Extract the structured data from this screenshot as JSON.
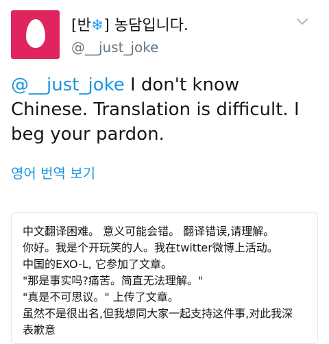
{
  "user": {
    "name_prefix": "[반",
    "name_emoji": "❄",
    "name_suffix": "] 농담입니다.",
    "handle": "@__just_joke"
  },
  "tweet": {
    "mention": "@__just_joke",
    "text": " I don't know Chinese. Translation is difficult. I beg your pardon."
  },
  "translate_link": "영어 번역 보기",
  "translation": {
    "lines": [
      "中文翻译困难。 意义可能会错。 翻译错误,请理解。",
      "你好。我是个开玩笑的人。我在twitter微博上活动。",
      "中国的EXO-L, 它参加了文章。",
      "\"那是事实吗?痛苦。简直无法理解。\"",
      "\"真是不可思议。\" 上传了文章。",
      "虽然不是很出名,但我想同大家一起支持这件事,对此我深",
      "表歉意"
    ]
  },
  "icons": {
    "avatar": "default-egg-avatar",
    "menu": "chevron-down-icon"
  },
  "colors": {
    "avatar_bg": "#e0245e",
    "link": "#1b95e0",
    "secondary_text": "#657786",
    "border": "#e1e8ed"
  }
}
